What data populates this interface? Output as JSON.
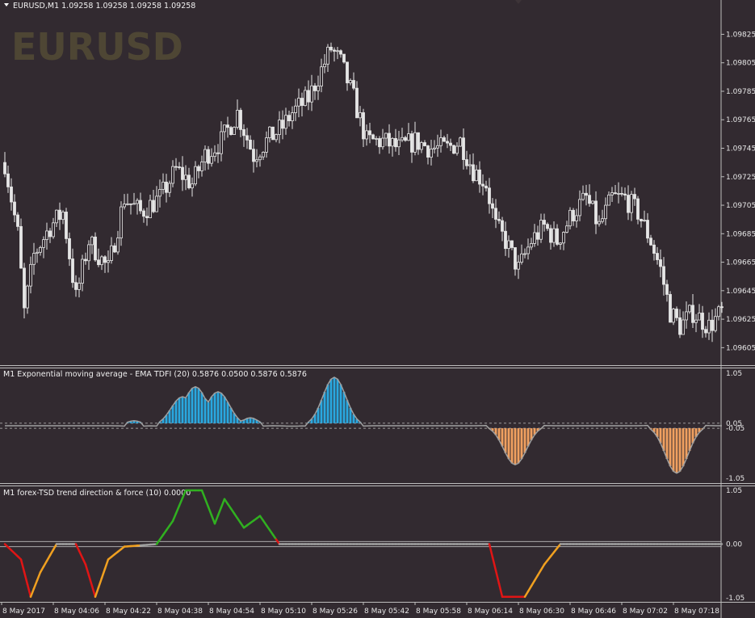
{
  "header": {
    "symbol_line": "EURUSD,M1  1.09258 1.09258 1.09258 1.09258",
    "watermark": "EURUSD"
  },
  "colors": {
    "background": "#322a30",
    "candle": "#e6e6e6",
    "grid_line": "#bdbdbd",
    "hist_up": "#29a8e0",
    "hist_down": "#f0a060",
    "tsd_red": "#e01515",
    "tsd_orange": "#f0a020",
    "tsd_green": "#30b020",
    "tsd_neutral": "#a0a0a0"
  },
  "price_panel": {
    "price_labels": [
      "1.09825",
      "1.09805",
      "1.09785",
      "1.09765",
      "1.09745",
      "1.09725",
      "1.09705",
      "1.09685",
      "1.09665",
      "1.09645",
      "1.09625",
      "1.09605"
    ],
    "ylim": [
      1.09595,
      1.0984
    ]
  },
  "indicator1": {
    "title": "M1 Exponential moving average - EMA TDFI (20) 0.5876 0.0500 0.5876 0.5876",
    "scale_labels": [
      "1.05",
      "0.05",
      "-0.05",
      "-1.05"
    ],
    "levels": [
      0.05,
      -0.05
    ],
    "ylim": [
      -1.05,
      1.05
    ]
  },
  "indicator2": {
    "title": "M1 forex-TSD trend direction & force (10) 0.0000",
    "scale_labels": [
      "1.05",
      "0.00",
      "-1.05"
    ],
    "ylim": [
      -1.05,
      1.05
    ]
  },
  "time_labels": [
    "8 May 2017",
    "8 May 04:06",
    "8 May 04:22",
    "8 May 04:38",
    "8 May 04:54",
    "8 May 05:10",
    "8 May 05:26",
    "8 May 05:42",
    "8 May 05:58",
    "8 May 06:14",
    "8 May 06:30",
    "8 May 06:46",
    "8 May 07:02",
    "8 May 07:18"
  ],
  "chart_data": [
    {
      "type": "candlestick",
      "title": "EURUSD,M1",
      "ylim": [
        1.09595,
        1.0984
      ],
      "price_path_keypoints": [
        {
          "bar": 0,
          "price": 1.09735
        },
        {
          "bar": 4,
          "price": 1.09685
        },
        {
          "bar": 6,
          "price": 1.0963
        },
        {
          "bar": 9,
          "price": 1.0967
        },
        {
          "bar": 14,
          "price": 1.0969
        },
        {
          "bar": 18,
          "price": 1.097
        },
        {
          "bar": 22,
          "price": 1.0964
        },
        {
          "bar": 26,
          "price": 1.0968
        },
        {
          "bar": 32,
          "price": 1.0966
        },
        {
          "bar": 37,
          "price": 1.0971
        },
        {
          "bar": 42,
          "price": 1.097
        },
        {
          "bar": 48,
          "price": 1.0971
        },
        {
          "bar": 53,
          "price": 1.0973
        },
        {
          "bar": 58,
          "price": 1.0972
        },
        {
          "bar": 62,
          "price": 1.0974
        },
        {
          "bar": 67,
          "price": 1.0975
        },
        {
          "bar": 72,
          "price": 1.0977
        },
        {
          "bar": 77,
          "price": 1.0974
        },
        {
          "bar": 81,
          "price": 1.0975
        },
        {
          "bar": 86,
          "price": 1.0976
        },
        {
          "bar": 89,
          "price": 1.0977
        },
        {
          "bar": 94,
          "price": 1.0978
        },
        {
          "bar": 98,
          "price": 1.098
        },
        {
          "bar": 101,
          "price": 1.09815
        },
        {
          "bar": 104,
          "price": 1.09805
        },
        {
          "bar": 108,
          "price": 1.0978
        },
        {
          "bar": 112,
          "price": 1.0975
        },
        {
          "bar": 117,
          "price": 1.0975
        },
        {
          "bar": 122,
          "price": 1.09745
        },
        {
          "bar": 127,
          "price": 1.0975
        },
        {
          "bar": 132,
          "price": 1.09745
        },
        {
          "bar": 137,
          "price": 1.09745
        },
        {
          "bar": 141,
          "price": 1.0975
        },
        {
          "bar": 145,
          "price": 1.0973
        },
        {
          "bar": 149,
          "price": 1.0972
        },
        {
          "bar": 152,
          "price": 1.0969
        },
        {
          "bar": 155,
          "price": 1.0968
        },
        {
          "bar": 159,
          "price": 1.0966
        },
        {
          "bar": 163,
          "price": 1.0968
        },
        {
          "bar": 167,
          "price": 1.0969
        },
        {
          "bar": 171,
          "price": 1.0968
        },
        {
          "bar": 176,
          "price": 1.097
        },
        {
          "bar": 180,
          "price": 1.0971
        },
        {
          "bar": 184,
          "price": 1.0969
        },
        {
          "bar": 188,
          "price": 1.0971
        },
        {
          "bar": 192,
          "price": 1.0971
        },
        {
          "bar": 196,
          "price": 1.097
        },
        {
          "bar": 200,
          "price": 1.0968
        },
        {
          "bar": 203,
          "price": 1.0966
        },
        {
          "bar": 206,
          "price": 1.0963
        },
        {
          "bar": 209,
          "price": 1.0962
        },
        {
          "bar": 213,
          "price": 1.0963
        },
        {
          "bar": 218,
          "price": 1.0962
        },
        {
          "bar": 222,
          "price": 1.0963
        }
      ]
    },
    {
      "type": "histogram",
      "title": "EMA TDFI (20)",
      "ylim": [
        -1.05,
        1.05
      ],
      "peaks": [
        {
          "bar": 40,
          "value": 0.1
        },
        {
          "bar": 55,
          "value": 0.58
        },
        {
          "bar": 59,
          "value": 0.78
        },
        {
          "bar": 66,
          "value": 0.68
        },
        {
          "bar": 76,
          "value": 0.16
        },
        {
          "bar": 89,
          "value": 0.05
        },
        {
          "bar": 102,
          "value": 0.97
        },
        {
          "bar": 158,
          "value": -0.78
        },
        {
          "bar": 208,
          "value": -0.95
        }
      ]
    },
    {
      "type": "line",
      "title": "forex-TSD trend direction & force (10)",
      "ylim": [
        -1.05,
        1.05
      ],
      "keypoints": [
        {
          "bar": 0,
          "value": 0
        },
        {
          "bar": 5,
          "value": -0.3
        },
        {
          "bar": 8,
          "value": -1.03
        },
        {
          "bar": 11,
          "value": -0.55
        },
        {
          "bar": 16,
          "value": 0
        },
        {
          "bar": 22,
          "value": 0
        },
        {
          "bar": 25,
          "value": -0.4
        },
        {
          "bar": 28,
          "value": -1.03
        },
        {
          "bar": 32,
          "value": -0.3
        },
        {
          "bar": 37,
          "value": -0.05
        },
        {
          "bar": 47,
          "value": 0
        },
        {
          "bar": 52,
          "value": 0.45
        },
        {
          "bar": 56,
          "value": 1.05
        },
        {
          "bar": 61,
          "value": 1.05
        },
        {
          "bar": 65,
          "value": 0.4
        },
        {
          "bar": 68,
          "value": 0.88
        },
        {
          "bar": 74,
          "value": 0.32
        },
        {
          "bar": 79,
          "value": 0.55
        },
        {
          "bar": 85,
          "value": 0
        },
        {
          "bar": 150,
          "value": 0
        },
        {
          "bar": 154,
          "value": -1.03
        },
        {
          "bar": 161,
          "value": -1.03
        },
        {
          "bar": 167,
          "value": -0.4
        },
        {
          "bar": 172,
          "value": 0
        },
        {
          "bar": 222,
          "value": 0
        }
      ]
    }
  ]
}
